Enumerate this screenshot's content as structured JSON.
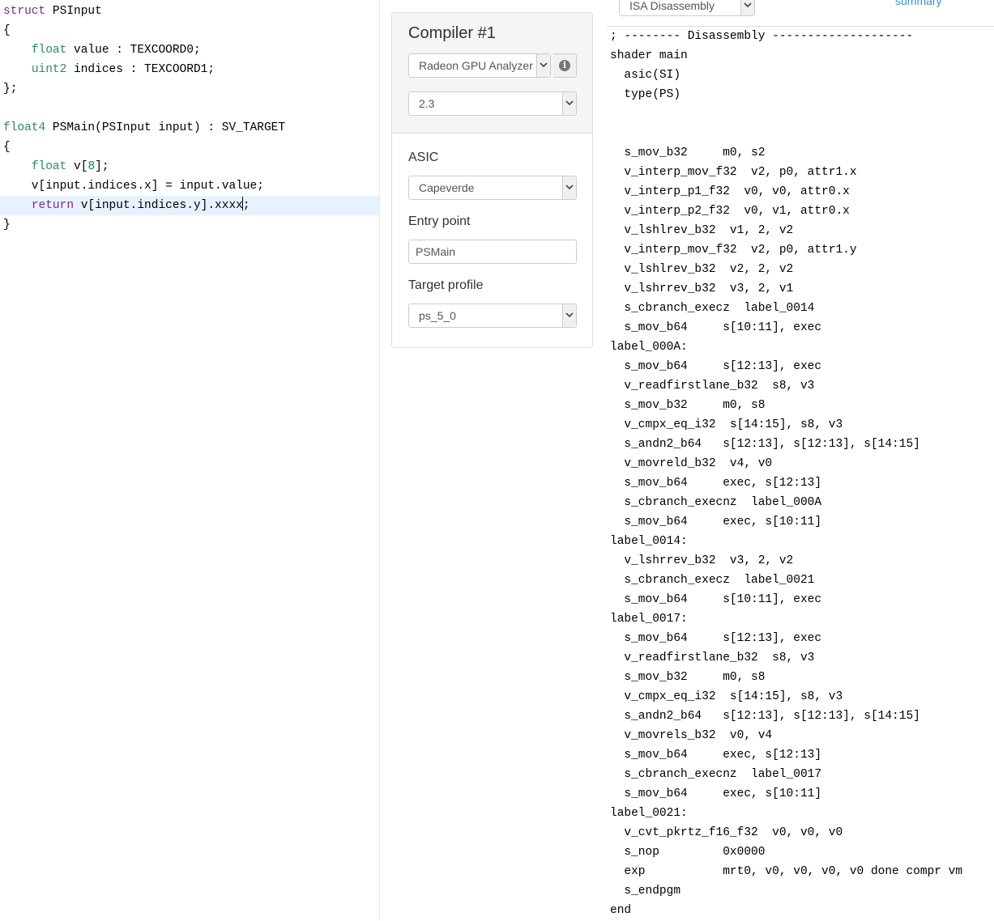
{
  "editor": {
    "lines": [
      {
        "parts": [
          {
            "t": "struct",
            "c": "kw-purple"
          },
          {
            "t": " PSInput"
          }
        ]
      },
      {
        "parts": [
          {
            "t": "{"
          }
        ]
      },
      {
        "parts": [
          {
            "t": "    "
          },
          {
            "t": "float",
            "c": "kw-green"
          },
          {
            "t": " value : TEXCOORD0;"
          }
        ]
      },
      {
        "parts": [
          {
            "t": "    "
          },
          {
            "t": "uint2",
            "c": "kw-green"
          },
          {
            "t": " indices : TEXCOORD1;"
          }
        ]
      },
      {
        "parts": [
          {
            "t": "};"
          }
        ]
      },
      {
        "parts": []
      },
      {
        "parts": [
          {
            "t": "float4",
            "c": "kw-green"
          },
          {
            "t": " PSMain(PSInput input) : SV_TARGET"
          }
        ]
      },
      {
        "parts": [
          {
            "t": "{"
          }
        ]
      },
      {
        "parts": [
          {
            "t": "    "
          },
          {
            "t": "float",
            "c": "kw-green"
          },
          {
            "t": " v["
          },
          {
            "t": "8",
            "c": "num"
          },
          {
            "t": "];"
          }
        ]
      },
      {
        "parts": [
          {
            "t": "    v[input.indices.x] = input.value;"
          }
        ]
      },
      {
        "parts": [
          {
            "t": "    "
          },
          {
            "t": "return",
            "c": "kw-purple"
          },
          {
            "t": " v[input.indices.y].xxxx"
          },
          {
            "t": "",
            "cursor": true
          },
          {
            "t": ";"
          }
        ],
        "current": true
      },
      {
        "parts": [
          {
            "t": "}"
          }
        ]
      }
    ]
  },
  "compiler": {
    "title": "Compiler #1",
    "compiler_select": "Radeon GPU Analyzer",
    "version_select": "2.3",
    "asic_label": "ASIC",
    "asic_select": "Capeverde",
    "entry_label": "Entry point",
    "entry_value": "PSMain",
    "profile_label": "Target profile",
    "profile_select": "ps_5_0"
  },
  "output": {
    "view_select": "ISA Disassembly",
    "summary_link": "summary",
    "lines": [
      "; -------- Disassembly --------------------",
      "shader main",
      "  asic(SI)",
      "  type(PS)",
      "",
      "",
      "  s_mov_b32     m0, s2",
      "  v_interp_mov_f32  v2, p0, attr1.x",
      "  v_interp_p1_f32  v0, v0, attr0.x",
      "  v_interp_p2_f32  v0, v1, attr0.x",
      "  v_lshlrev_b32  v1, 2, v2",
      "  v_interp_mov_f32  v2, p0, attr1.y",
      "  v_lshlrev_b32  v2, 2, v2",
      "  v_lshrrev_b32  v3, 2, v1",
      "  s_cbranch_execz  label_0014",
      "  s_mov_b64     s[10:11], exec",
      "label_000A:",
      "  s_mov_b64     s[12:13], exec",
      "  v_readfirstlane_b32  s8, v3",
      "  s_mov_b32     m0, s8",
      "  v_cmpx_eq_i32  s[14:15], s8, v3",
      "  s_andn2_b64   s[12:13], s[12:13], s[14:15]",
      "  v_movreld_b32  v4, v0",
      "  s_mov_b64     exec, s[12:13]",
      "  s_cbranch_execnz  label_000A",
      "  s_mov_b64     exec, s[10:11]",
      "label_0014:",
      "  v_lshrrev_b32  v3, 2, v2",
      "  s_cbranch_execz  label_0021",
      "  s_mov_b64     s[10:11], exec",
      "label_0017:",
      "  s_mov_b64     s[12:13], exec",
      "  v_readfirstlane_b32  s8, v3",
      "  s_mov_b32     m0, s8",
      "  v_cmpx_eq_i32  s[14:15], s8, v3",
      "  s_andn2_b64   s[12:13], s[12:13], s[14:15]",
      "  v_movrels_b32  v0, v4",
      "  s_mov_b64     exec, s[12:13]",
      "  s_cbranch_execnz  label_0017",
      "  s_mov_b64     exec, s[10:11]",
      "label_0021:",
      "  v_cvt_pkrtz_f16_f32  v0, v0, v0",
      "  s_nop         0x0000",
      "  exp           mrt0, v0, v0, v0, v0 done compr vm",
      "  s_endpgm",
      "end"
    ]
  },
  "colors": {
    "keyword_purple": "#7a2a85",
    "keyword_green": "#2e8b57",
    "current_line": "#e8f2ff",
    "link": "#3a8fd8"
  }
}
